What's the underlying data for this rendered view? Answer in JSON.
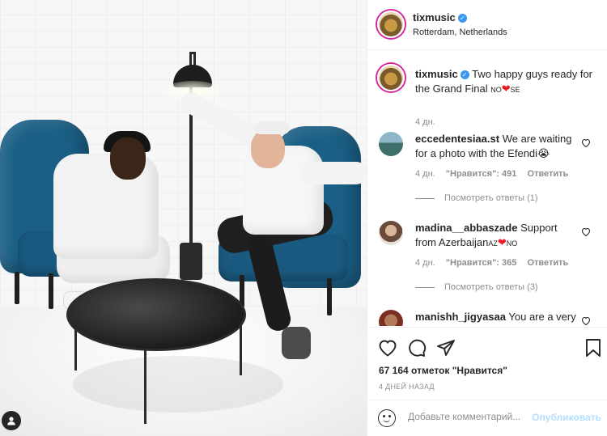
{
  "post": {
    "username": "tixmusic",
    "location": "Rotterdam, Netherlands",
    "verified_icon": "verified-badge-icon",
    "more_icon": "more-options-icon"
  },
  "caption": {
    "username": "tixmusic",
    "text": "Two happy guys ready for the Grand Final",
    "suffix_pre": "NO",
    "suffix_heart": "❤️",
    "suffix_post": "SE",
    "time": "4 дн."
  },
  "comments": [
    {
      "username": "eccedentesiaa.st",
      "text": "We are waiting for a photo with the Efendi",
      "emoji": "😭",
      "time": "4 дн.",
      "likes": "\"Нравится\": 491",
      "reply": "Ответить",
      "view_replies": "Посмотреть ответы (1)"
    },
    {
      "username": "madina__abbaszade",
      "text": "Support from Azerbaijan",
      "suffix_pre": "AZ",
      "suffix_heart": "❤️",
      "suffix_post": "NO",
      "time": "4 дн.",
      "likes": "\"Нравится\": 365",
      "reply": "Ответить",
      "view_replies": "Посмотреть ответы (3)"
    },
    {
      "username": "manishh_jigyasaa",
      "text": "You are a very"
    }
  ],
  "actions": {
    "likes": "67 164 отметок \"Нравится\"",
    "date": "4 ДНЕЙ НАЗАД"
  },
  "add_comment": {
    "placeholder": "Добавьте комментарий...",
    "publish": "Опубликовать"
  },
  "colors": {
    "link_blue": "#3897f0",
    "publish_disabled": "#b2dffc",
    "heart_red": "#ed1c24",
    "chair_blue": "#1b5f86"
  }
}
